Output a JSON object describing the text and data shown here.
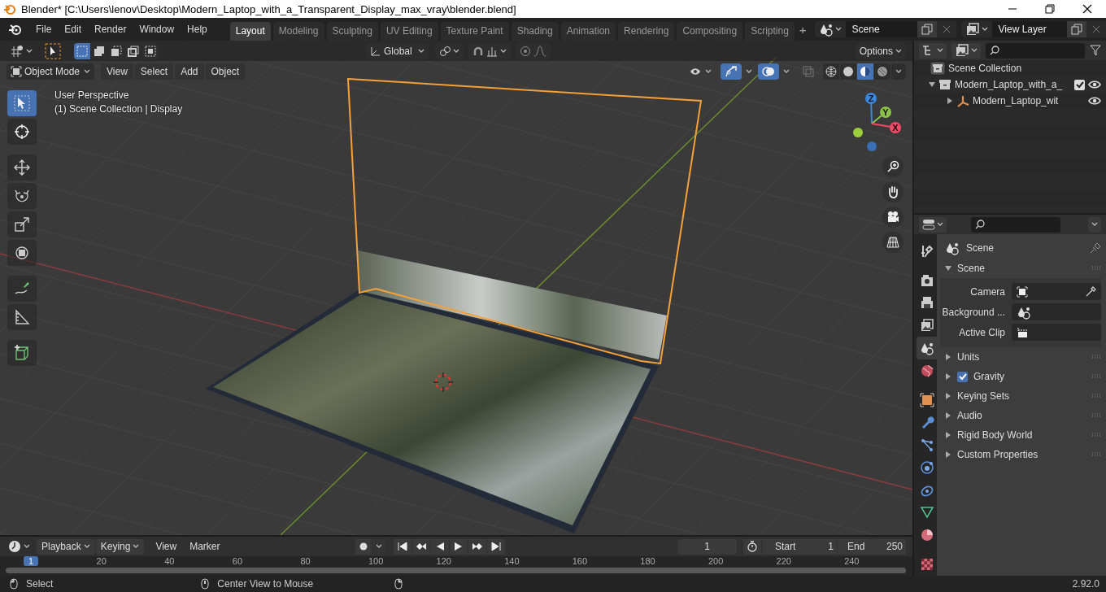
{
  "window": {
    "title": "Blender* [C:\\Users\\lenov\\Desktop\\Modern_Laptop_with_a_Transparent_Display_max_vray\\blender.blend]"
  },
  "menu": [
    "File",
    "Edit",
    "Render",
    "Window",
    "Help"
  ],
  "workspaces": [
    {
      "label": "Layout",
      "selected": true
    },
    {
      "label": "Modeling",
      "selected": false
    },
    {
      "label": "Sculpting",
      "selected": false
    },
    {
      "label": "UV Editing",
      "selected": false
    },
    {
      "label": "Texture Paint",
      "selected": false
    },
    {
      "label": "Shading",
      "selected": false
    },
    {
      "label": "Animation",
      "selected": false
    },
    {
      "label": "Rendering",
      "selected": false
    },
    {
      "label": "Compositing",
      "selected": false
    },
    {
      "label": "Scripting",
      "selected": false
    }
  ],
  "add_workspace": "+",
  "scene": {
    "value": "Scene"
  },
  "view_layer": {
    "value": "View Layer"
  },
  "viewport": {
    "selection_modes": [
      {
        "kind": "set",
        "selected": true
      },
      {
        "kind": "extend",
        "selected": false
      },
      {
        "kind": "subtract",
        "selected": false
      },
      {
        "kind": "invert",
        "selected": false
      },
      {
        "kind": "intersect",
        "selected": false
      }
    ],
    "orientation": "Global",
    "options": "Options",
    "mode": "Object Mode",
    "menus": [
      "View",
      "Select",
      "Add",
      "Object"
    ],
    "show_gizmos": true,
    "show_overlays": true,
    "shading": [
      {
        "kind": "wireframe",
        "selected": false
      },
      {
        "kind": "solid",
        "selected": false
      },
      {
        "kind": "material",
        "selected": true
      },
      {
        "kind": "rendered",
        "selected": false
      }
    ],
    "info": [
      "User Perspective",
      "(1) Scene Collection | Display"
    ],
    "axes": [
      "Z",
      "Y",
      "X"
    ]
  },
  "tools": [
    {
      "kind": "select",
      "selected": true
    },
    {
      "kind": "cursor",
      "selected": false
    },
    {
      "kind": "move",
      "selected": false
    },
    {
      "kind": "rotate",
      "selected": false
    },
    {
      "kind": "scale",
      "selected": false
    },
    {
      "kind": "transform",
      "selected": false
    },
    {
      "kind": "annotate",
      "selected": false
    },
    {
      "kind": "measure",
      "selected": false
    },
    {
      "kind": "add-cube",
      "selected": false
    }
  ],
  "outliner": {
    "root": "Scene Collection",
    "items": [
      {
        "kind": "collection",
        "label": "Modern_Laptop_with_a_",
        "expanded": true,
        "checked": true,
        "children": [
          {
            "kind": "empty",
            "label": "Modern_Laptop_wit",
            "expanded": false
          }
        ]
      }
    ]
  },
  "properties": {
    "tabs": [
      {
        "kind": "tool",
        "selected": false
      },
      {
        "kind": "render",
        "selected": false
      },
      {
        "kind": "output",
        "selected": false
      },
      {
        "kind": "view-layer",
        "selected": false
      },
      {
        "kind": "scene",
        "selected": true
      },
      {
        "kind": "world",
        "selected": false
      },
      {
        "kind": "object",
        "selected": false
      },
      {
        "kind": "modifiers",
        "selected": false
      },
      {
        "kind": "particles",
        "selected": false
      },
      {
        "kind": "physics",
        "selected": false
      },
      {
        "kind": "constraints",
        "selected": false
      },
      {
        "kind": "data",
        "selected": false
      },
      {
        "kind": "material",
        "selected": false
      },
      {
        "kind": "texture",
        "selected": false
      }
    ],
    "context": "Scene",
    "panels": [
      {
        "label": "Scene",
        "expanded": true,
        "fields": [
          {
            "kind": "camera",
            "label": "Camera"
          },
          {
            "kind": "scene",
            "label": "Background ..."
          },
          {
            "kind": "clip",
            "label": "Active Clip"
          }
        ]
      },
      {
        "label": "Units",
        "expanded": false
      },
      {
        "label": "Gravity",
        "expanded": false,
        "toggle": {
          "checked": true
        }
      },
      {
        "label": "Keying Sets",
        "expanded": false
      },
      {
        "label": "Audio",
        "expanded": false
      },
      {
        "label": "Rigid Body World",
        "expanded": false
      },
      {
        "label": "Custom Properties",
        "expanded": false
      }
    ]
  },
  "timeline": {
    "menus": [
      "Playback",
      "Keying",
      "View",
      "Marker"
    ],
    "auto_keying": false,
    "current_frame": "1",
    "start_label": "Start",
    "start": "1",
    "end_label": "End",
    "end": "250",
    "ruler": [
      {
        "label": "1",
        "selected": true
      },
      {
        "label": "20",
        "selected": false
      },
      {
        "label": "40",
        "selected": false
      },
      {
        "label": "60",
        "selected": false
      },
      {
        "label": "80",
        "selected": false
      },
      {
        "label": "100",
        "selected": false
      },
      {
        "label": "120",
        "selected": false
      },
      {
        "label": "140",
        "selected": false
      },
      {
        "label": "160",
        "selected": false
      },
      {
        "label": "180",
        "selected": false
      },
      {
        "label": "200",
        "selected": false
      },
      {
        "label": "220",
        "selected": false
      },
      {
        "label": "240",
        "selected": false
      }
    ]
  },
  "status_bar": {
    "hints": [
      "Select",
      "Center View to Mouse"
    ],
    "version": "2.92.0"
  }
}
